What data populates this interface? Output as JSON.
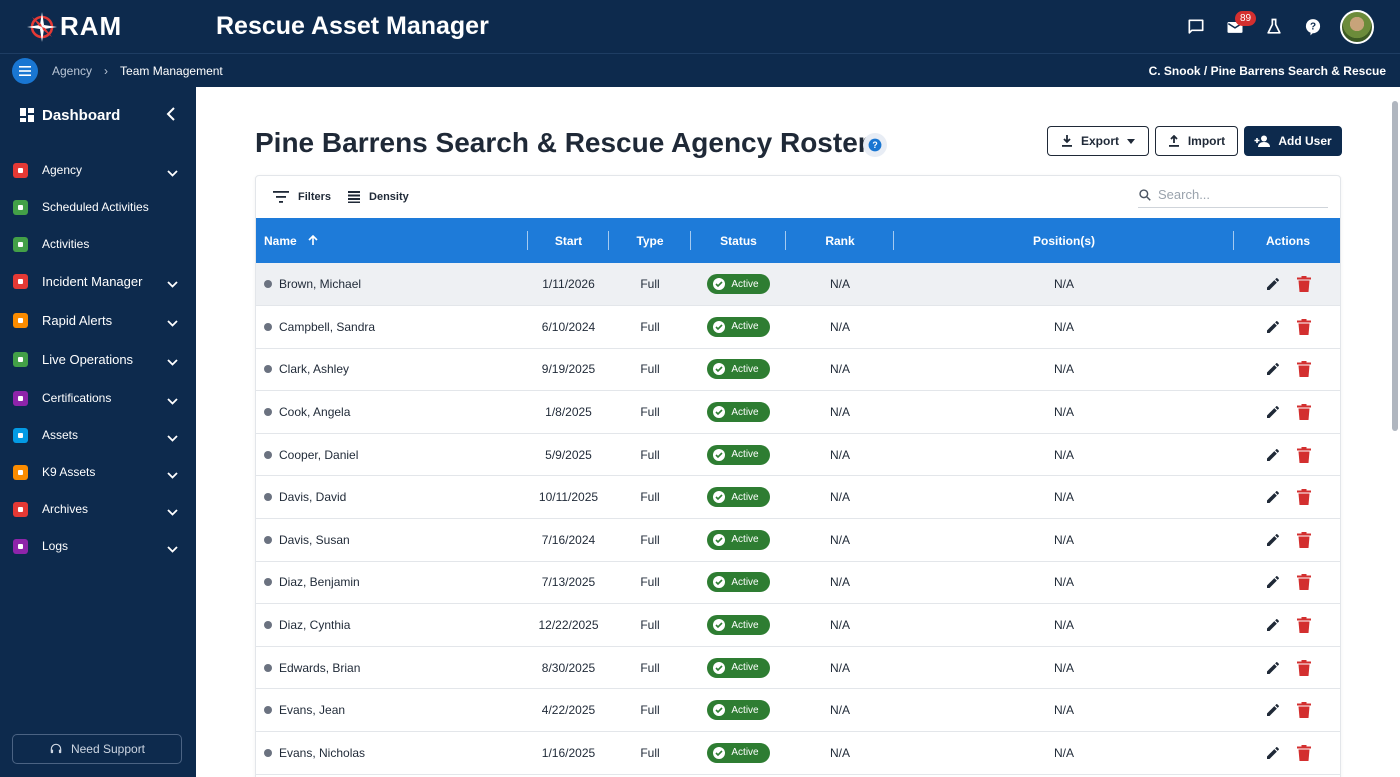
{
  "header": {
    "logo_text": "RAM",
    "app_title": "Rescue Asset Manager",
    "notification_count": "89"
  },
  "breadcrumb": {
    "items": [
      "Agency",
      "Team Management"
    ],
    "user_context": "C. Snook / Pine Barrens Search & Rescue"
  },
  "sidebar": {
    "dashboard_label": "Dashboard",
    "items": [
      {
        "label": "Agency",
        "color": "#e53935",
        "expandable": true
      },
      {
        "label": "Scheduled Activities",
        "color": "#43a047",
        "expandable": false
      },
      {
        "label": "Activities",
        "color": "#43a047",
        "expandable": false
      },
      {
        "label": "Incident Manager",
        "color": "#e53935",
        "expandable": true
      },
      {
        "label": "Rapid Alerts",
        "color": "#fb8c00",
        "expandable": true
      },
      {
        "label": "Live Operations",
        "color": "#43a047",
        "expandable": true
      },
      {
        "label": "Certifications",
        "color": "#8e24aa",
        "expandable": true
      },
      {
        "label": "Assets",
        "color": "#039be5",
        "expandable": true
      },
      {
        "label": "K9 Assets",
        "color": "#fb8c00",
        "expandable": true
      },
      {
        "label": "Archives",
        "color": "#e53935",
        "expandable": true
      },
      {
        "label": "Logs",
        "color": "#8e24aa",
        "expandable": true
      }
    ],
    "support_label": "Need Support"
  },
  "page": {
    "title": "Pine Barrens Search & Rescue Agency Roster",
    "export_label": "Export",
    "import_label": "Import",
    "add_user_label": "Add User"
  },
  "grid": {
    "filters_label": "Filters",
    "density_label": "Density",
    "search_placeholder": "Search...",
    "columns": [
      "Name",
      "Start",
      "Type",
      "Status",
      "Rank",
      "Position(s)",
      "Actions"
    ],
    "rows": [
      {
        "name": "Brown, Michael",
        "start": "1/11/2026",
        "type": "Full",
        "status": "Active",
        "rank": "N/A",
        "positions": "N/A"
      },
      {
        "name": "Campbell, Sandra",
        "start": "6/10/2024",
        "type": "Full",
        "status": "Active",
        "rank": "N/A",
        "positions": "N/A"
      },
      {
        "name": "Clark, Ashley",
        "start": "9/19/2025",
        "type": "Full",
        "status": "Active",
        "rank": "N/A",
        "positions": "N/A"
      },
      {
        "name": "Cook, Angela",
        "start": "1/8/2025",
        "type": "Full",
        "status": "Active",
        "rank": "N/A",
        "positions": "N/A"
      },
      {
        "name": "Cooper, Daniel",
        "start": "5/9/2025",
        "type": "Full",
        "status": "Active",
        "rank": "N/A",
        "positions": "N/A"
      },
      {
        "name": "Davis, David",
        "start": "10/11/2025",
        "type": "Full",
        "status": "Active",
        "rank": "N/A",
        "positions": "N/A"
      },
      {
        "name": "Davis, Susan",
        "start": "7/16/2024",
        "type": "Full",
        "status": "Active",
        "rank": "N/A",
        "positions": "N/A"
      },
      {
        "name": "Diaz, Benjamin",
        "start": "7/13/2025",
        "type": "Full",
        "status": "Active",
        "rank": "N/A",
        "positions": "N/A"
      },
      {
        "name": "Diaz, Cynthia",
        "start": "12/22/2025",
        "type": "Full",
        "status": "Active",
        "rank": "N/A",
        "positions": "N/A"
      },
      {
        "name": "Edwards, Brian",
        "start": "8/30/2025",
        "type": "Full",
        "status": "Active",
        "rank": "N/A",
        "positions": "N/A"
      },
      {
        "name": "Evans, Jean",
        "start": "4/22/2025",
        "type": "Full",
        "status": "Active",
        "rank": "N/A",
        "positions": "N/A"
      },
      {
        "name": "Evans, Nicholas",
        "start": "1/16/2025",
        "type": "Full",
        "status": "Active",
        "rank": "N/A",
        "positions": "N/A"
      }
    ]
  },
  "colors": {
    "navy": "#0d2a4d",
    "header_blue": "#1e7bd9",
    "status_green": "#2e7d32",
    "delete_red": "#d32f2f"
  }
}
